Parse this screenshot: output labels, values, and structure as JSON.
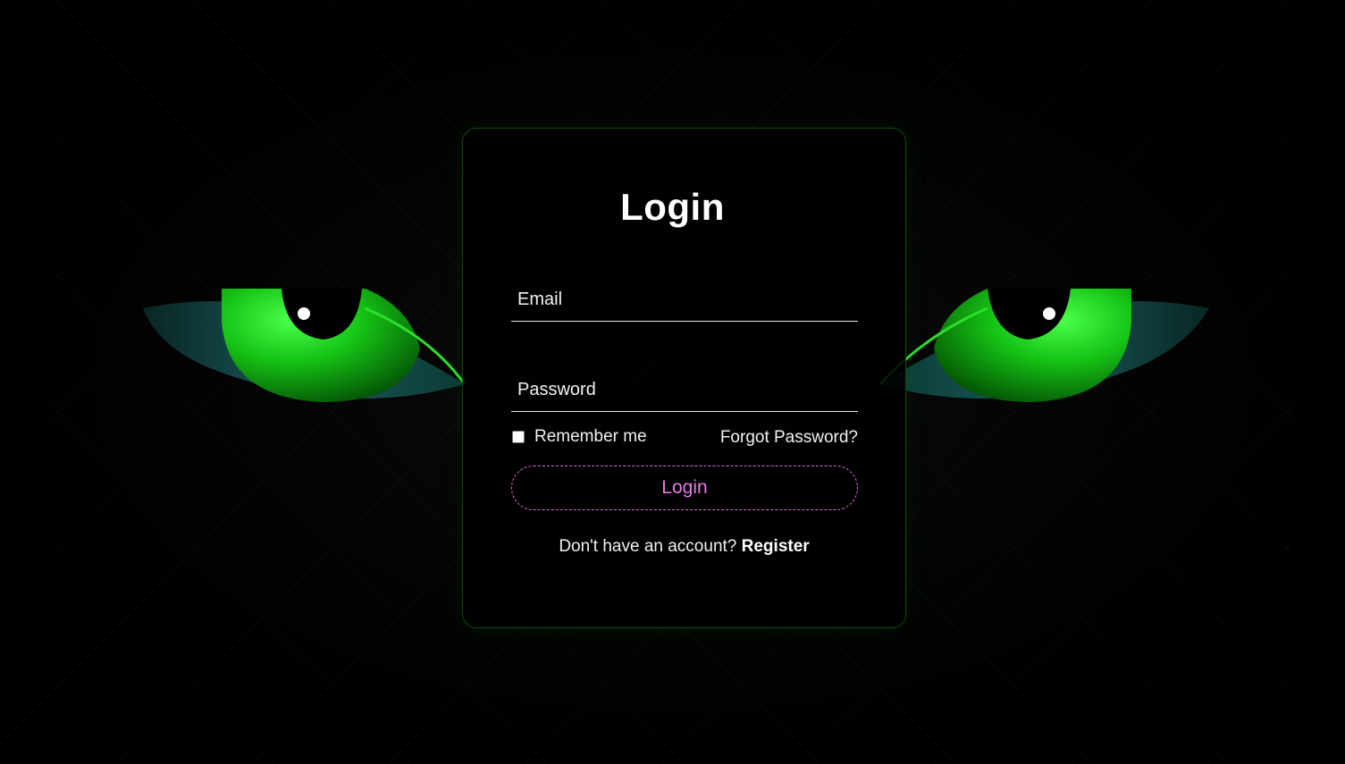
{
  "login": {
    "title": "Login",
    "email_placeholder": "Email",
    "password_placeholder": "Password",
    "remember_label": "Remember me",
    "forgot_label": "Forgot Password?",
    "button_label": "Login",
    "register_prompt": "Don't have an account?",
    "register_label": "Register"
  },
  "theme": {
    "background": "#000000",
    "card_border": "#0d4a0d",
    "button_accent": "#e57be5",
    "eye_green": "#1aa51a"
  },
  "icons": [
    "checkbox-icon",
    "green-eye-left-illustration",
    "green-eye-right-illustration"
  ]
}
